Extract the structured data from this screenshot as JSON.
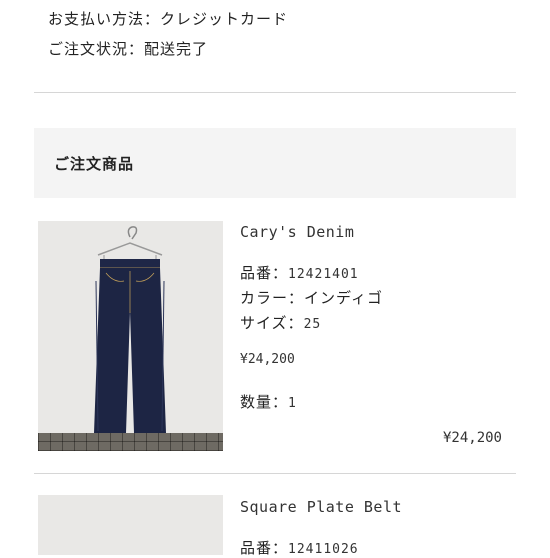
{
  "order_info": {
    "payment_method_label": "お支払い方法：",
    "payment_method_value": "クレジットカード",
    "order_status_label": "ご注文状況：",
    "order_status_value": "配送完了"
  },
  "section": {
    "title": "ご注文商品"
  },
  "items": [
    {
      "name": "Cary's Denim",
      "product_number_label": "品番：",
      "product_number": "12421401",
      "color_label": "カラー：",
      "color": "インディゴ",
      "size_label": "サイズ：",
      "size": "25",
      "price": "¥24,200",
      "quantity_label": "数量：",
      "quantity": "1",
      "subtotal": "¥24,200"
    },
    {
      "name": "Square Plate Belt",
      "product_number_label": "品番：",
      "product_number": "12411026"
    }
  ]
}
